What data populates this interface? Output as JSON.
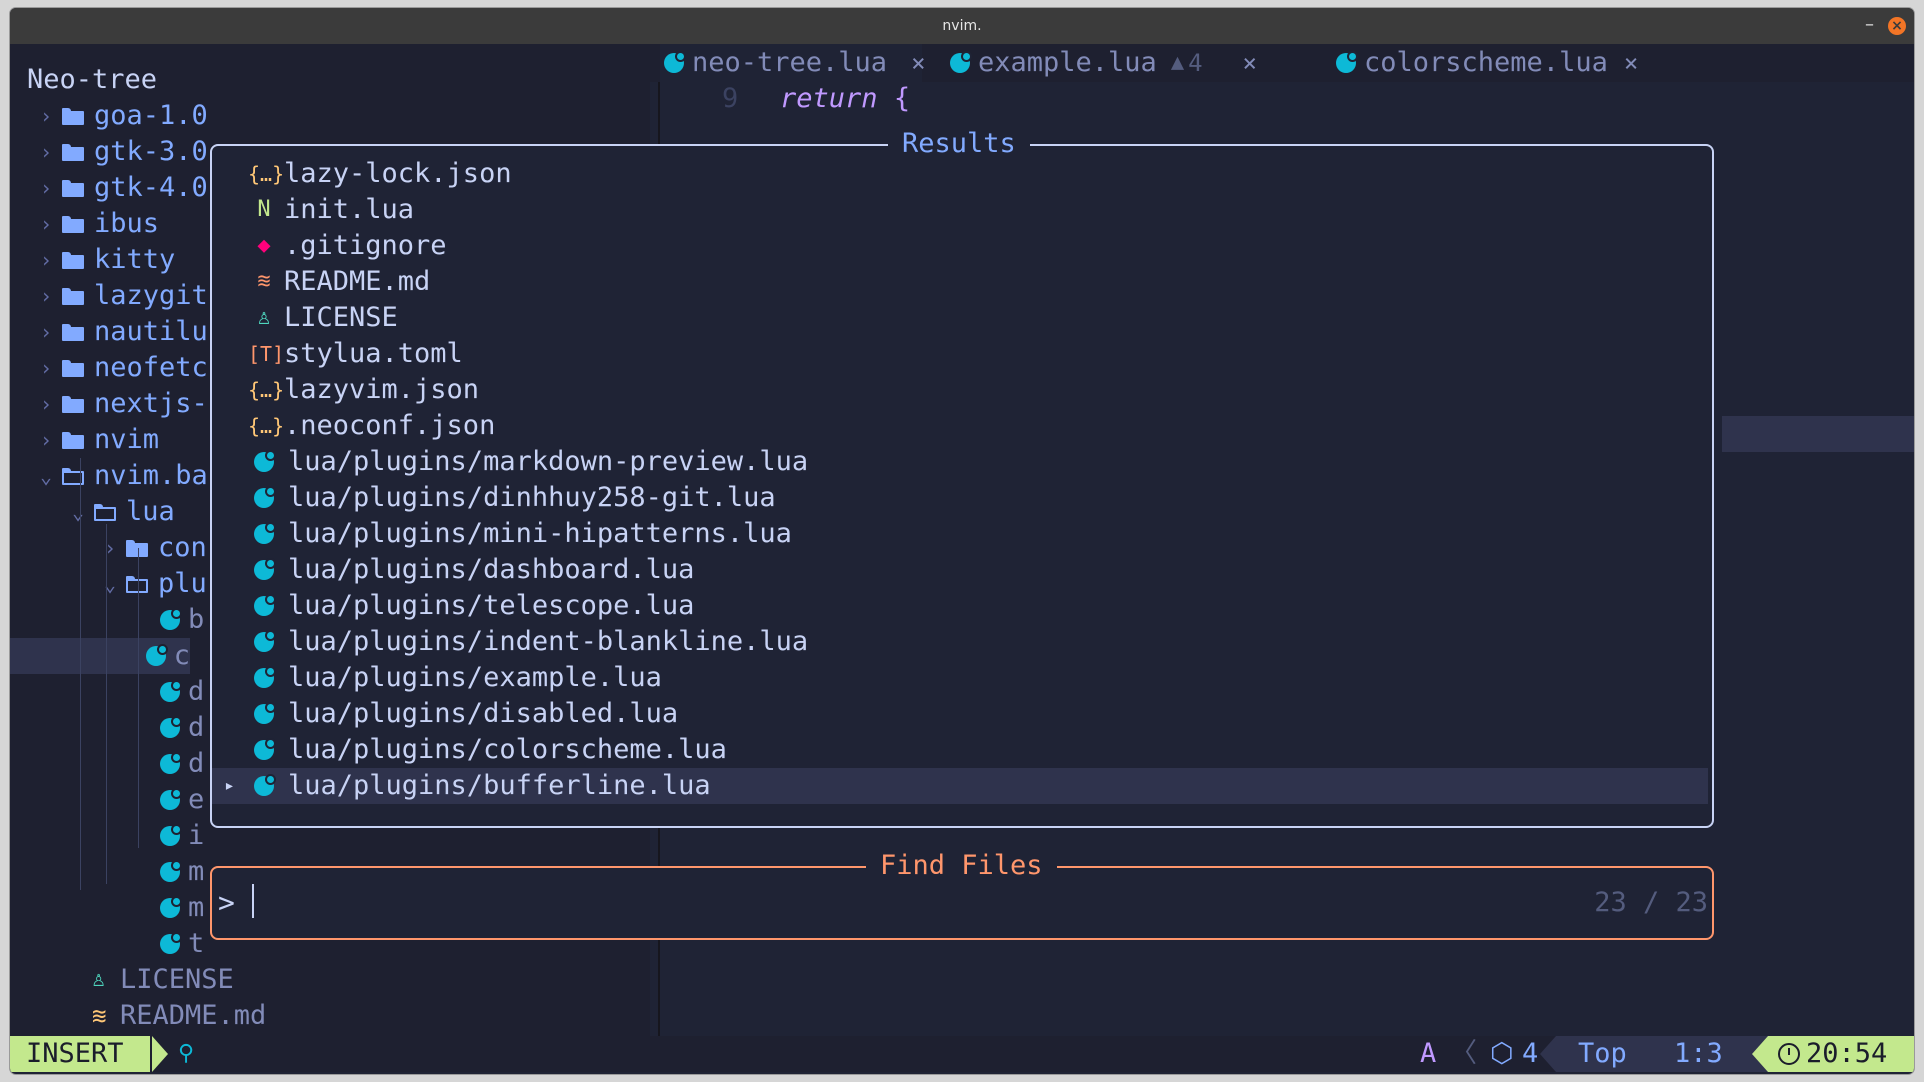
{
  "window": {
    "title": "nvim.",
    "minimize": "–",
    "close": "×"
  },
  "sidebar": {
    "header": "Neo-tree",
    "items": [
      {
        "label": "goa-1.0",
        "kind": "folder"
      },
      {
        "label": "gtk-3.0",
        "kind": "folder"
      },
      {
        "label": "gtk-4.0",
        "kind": "folder"
      },
      {
        "label": "ibus",
        "kind": "folder"
      },
      {
        "label": "kitty",
        "kind": "folder"
      },
      {
        "label": "lazygit",
        "kind": "folder"
      },
      {
        "label": "nautilu",
        "kind": "folder"
      },
      {
        "label": "neofetc",
        "kind": "folder"
      },
      {
        "label": "nextjs-",
        "kind": "folder"
      },
      {
        "label": "nvim",
        "kind": "folder"
      },
      {
        "label": "nvim.ba",
        "kind": "folder-open"
      },
      {
        "label": "lua",
        "kind": "folder-open"
      },
      {
        "label": "con",
        "kind": "folder"
      },
      {
        "label": "plu",
        "kind": "folder-open"
      },
      {
        "label": "b",
        "kind": "lua"
      },
      {
        "label": "c",
        "kind": "lua"
      },
      {
        "label": "d",
        "kind": "lua"
      },
      {
        "label": "d",
        "kind": "lua"
      },
      {
        "label": "d",
        "kind": "lua"
      },
      {
        "label": "e",
        "kind": "lua"
      },
      {
        "label": "i",
        "kind": "lua"
      },
      {
        "label": "m",
        "kind": "lua"
      },
      {
        "label": "m",
        "kind": "lua"
      },
      {
        "label": "t",
        "kind": "lua"
      },
      {
        "label": "LICENSE",
        "kind": "license"
      },
      {
        "label": "README.md",
        "kind": "readme"
      }
    ]
  },
  "tabs": [
    {
      "label": "neo-tree.lua",
      "close": "×"
    },
    {
      "label": "example.lua",
      "warning_count": "4",
      "close": "×"
    },
    {
      "label": "colorscheme.lua",
      "close": "×"
    }
  ],
  "editor": {
    "line_number": "9",
    "keyword": "return",
    "brace": "{"
  },
  "results": {
    "title": "Results",
    "items": [
      {
        "label": "lazy-lock.json",
        "icon": "{…}",
        "color": "#ffc777"
      },
      {
        "label": "init.lua",
        "icon": "N",
        "color": "#c3e88d"
      },
      {
        "label": ".gitignore",
        "icon": "◆",
        "color": "#ff007c"
      },
      {
        "label": "README.md",
        "icon": "≋",
        "color": "#ff966c"
      },
      {
        "label": "LICENSE",
        "icon": "♙",
        "color": "#4fd6be"
      },
      {
        "label": "stylua.toml",
        "icon": "[T]",
        "color": "#ff966c"
      },
      {
        "label": "lazyvim.json",
        "icon": "{…}",
        "color": "#ffc777"
      },
      {
        "label": ".neoconf.json",
        "icon": "{…}",
        "color": "#ffc777"
      },
      {
        "label": "lua/plugins/markdown-preview.lua",
        "icon": "lua"
      },
      {
        "label": "lua/plugins/dinhhuy258-git.lua",
        "icon": "lua"
      },
      {
        "label": "lua/plugins/mini-hipatterns.lua",
        "icon": "lua"
      },
      {
        "label": "lua/plugins/dashboard.lua",
        "icon": "lua"
      },
      {
        "label": "lua/plugins/telescope.lua",
        "icon": "lua"
      },
      {
        "label": "lua/plugins/indent-blankline.lua",
        "icon": "lua"
      },
      {
        "label": "lua/plugins/example.lua",
        "icon": "lua"
      },
      {
        "label": "lua/plugins/disabled.lua",
        "icon": "lua"
      },
      {
        "label": "lua/plugins/colorscheme.lua",
        "icon": "lua"
      },
      {
        "label": "lua/plugins/bufferline.lua",
        "icon": "lua",
        "selected": true
      }
    ]
  },
  "prompt": {
    "title": "Find Files",
    "chevron": ">",
    "count": "23 / 23"
  },
  "statusline": {
    "mode": "INSERT",
    "a_label": "A",
    "sep": "〈",
    "lsp_count": "4",
    "position": "Top",
    "cursor": "1:3",
    "time": "20:54"
  },
  "colors": {
    "background": "#1f2335",
    "sidebar": "#1e2030",
    "folder": "#82aaff",
    "lua": "#0db9d7",
    "mode": "#c3e88d",
    "prompt_border": "#ff966c"
  }
}
